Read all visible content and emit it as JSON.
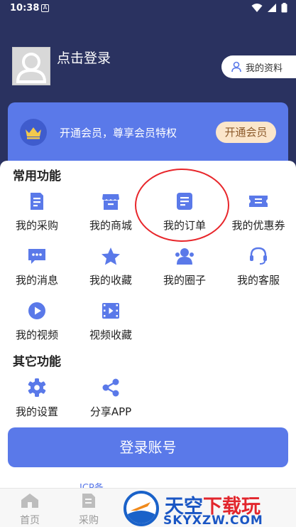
{
  "status_bar": {
    "time": "10:38",
    "a_badge": "A"
  },
  "header": {
    "login_prompt": "点击登录",
    "profile_button": "我的资料"
  },
  "vip": {
    "text": "开通会员，尊享会员特权",
    "button": "开通会员"
  },
  "common": {
    "title": "常用功能",
    "items": [
      {
        "label": "我的采购",
        "icon": "purchase-icon"
      },
      {
        "label": "我的商城",
        "icon": "store-icon"
      },
      {
        "label": "我的订单",
        "icon": "order-icon"
      },
      {
        "label": "我的优惠券",
        "icon": "coupon-icon"
      },
      {
        "label": "我的消息",
        "icon": "message-icon"
      },
      {
        "label": "我的收藏",
        "icon": "star-icon"
      },
      {
        "label": "我的圈子",
        "icon": "circle-icon"
      },
      {
        "label": "我的客服",
        "icon": "headset-icon"
      },
      {
        "label": "我的视频",
        "icon": "play-icon"
      },
      {
        "label": "视频收藏",
        "icon": "film-icon"
      }
    ]
  },
  "other": {
    "title": "其它功能",
    "items": [
      {
        "label": "我的设置",
        "icon": "gear-icon"
      },
      {
        "label": "分享APP",
        "icon": "share-icon"
      }
    ]
  },
  "login_button": "登录账号",
  "icp": "ICP备",
  "tabs": [
    {
      "label": "首页",
      "icon": "home-icon"
    },
    {
      "label": "采购",
      "icon": "purchase-tab-icon"
    }
  ],
  "watermark": {
    "title_part1": "天空",
    "title_part2": "下载玩",
    "url": "SKYXZW.COM"
  },
  "colors": {
    "header_bg": "#2a3260",
    "accent": "#5a79e9",
    "vip_button_bg": "#fbe6cb",
    "highlight": "#e8262b"
  }
}
